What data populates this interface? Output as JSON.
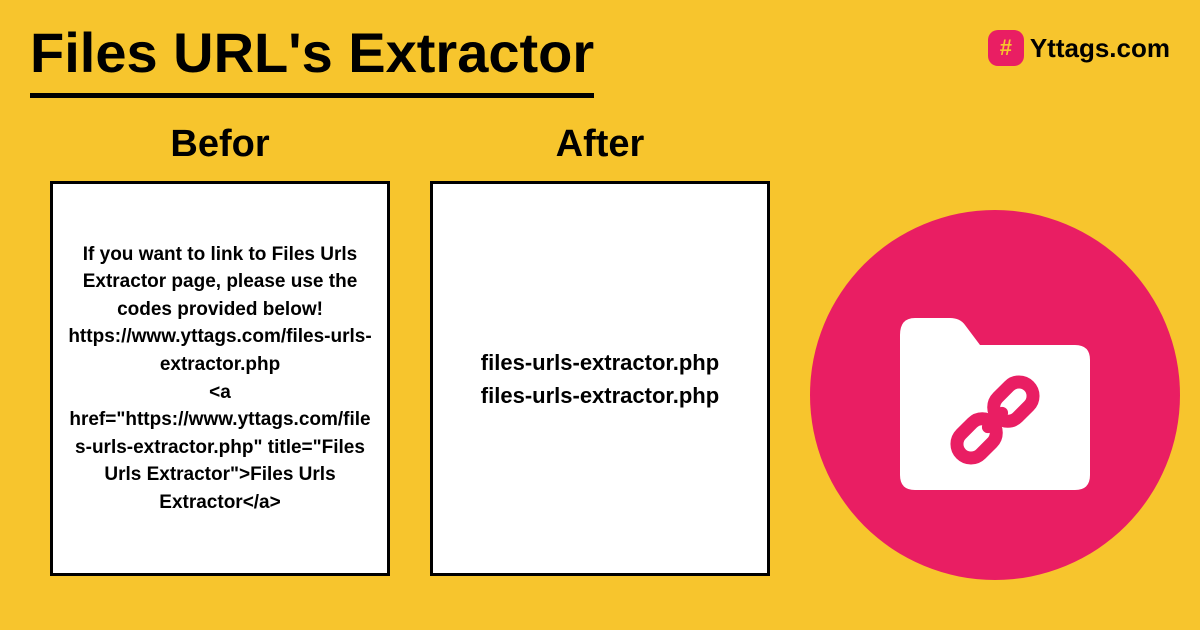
{
  "header": {
    "title": "Files URL's Extractor"
  },
  "brand": {
    "name": "Yttags.com",
    "icon_symbol": "#"
  },
  "columns": {
    "before": {
      "label": "Befor",
      "content": "If you want to link to Files Urls Extractor page, please use the codes provided below!\nhttps://www.yttags.com/files-urls-extractor.php\n<a href=\"https://www.yttags.com/files-urls-extractor.php\" title=\"Files Urls Extractor\">Files Urls Extractor</a>"
    },
    "after": {
      "label": "After",
      "line1": "files-urls-extractor.php",
      "line2": "files-urls-extractor.php"
    }
  },
  "icons": {
    "main": "folder-link-icon",
    "brand": "hashtag-icon"
  },
  "colors": {
    "background": "#f7c52d",
    "accent": "#e91e63",
    "text": "#000000",
    "box_bg": "#ffffff"
  }
}
